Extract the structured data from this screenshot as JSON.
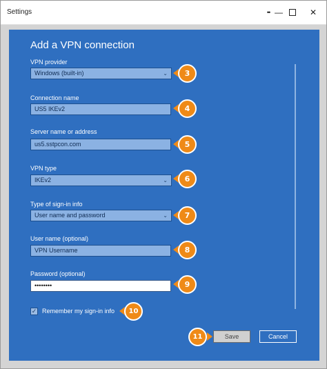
{
  "window": {
    "title": "Settings",
    "pin_glyph": "••",
    "minimize_glyph": "—",
    "close_glyph": "✕"
  },
  "dialog": {
    "heading": "Add a VPN connection",
    "vpn_provider": {
      "label": "VPN provider",
      "value": "Windows (built-in)"
    },
    "connection_name": {
      "label": "Connection name",
      "value": "US5 IKEv2"
    },
    "server": {
      "label": "Server name or address",
      "value": "us5.sstpcon.com"
    },
    "vpn_type": {
      "label": "VPN type",
      "value": "IKEv2"
    },
    "signin_type": {
      "label": "Type of sign-in info",
      "value": "User name and password"
    },
    "username": {
      "label": "User name (optional)",
      "value": "VPN Username"
    },
    "password": {
      "label": "Password (optional)",
      "value": "••••••••"
    },
    "remember": {
      "label": "Remember my sign-in info",
      "checked": true,
      "check_glyph": "✓"
    },
    "save_label": "Save",
    "cancel_label": "Cancel",
    "chevron_glyph": "⌄"
  },
  "callouts": [
    "3",
    "4",
    "5",
    "6",
    "7",
    "8",
    "9",
    "10",
    "11"
  ],
  "colors": {
    "panel": "#2f6fc0",
    "badge": "#ef8a17"
  }
}
